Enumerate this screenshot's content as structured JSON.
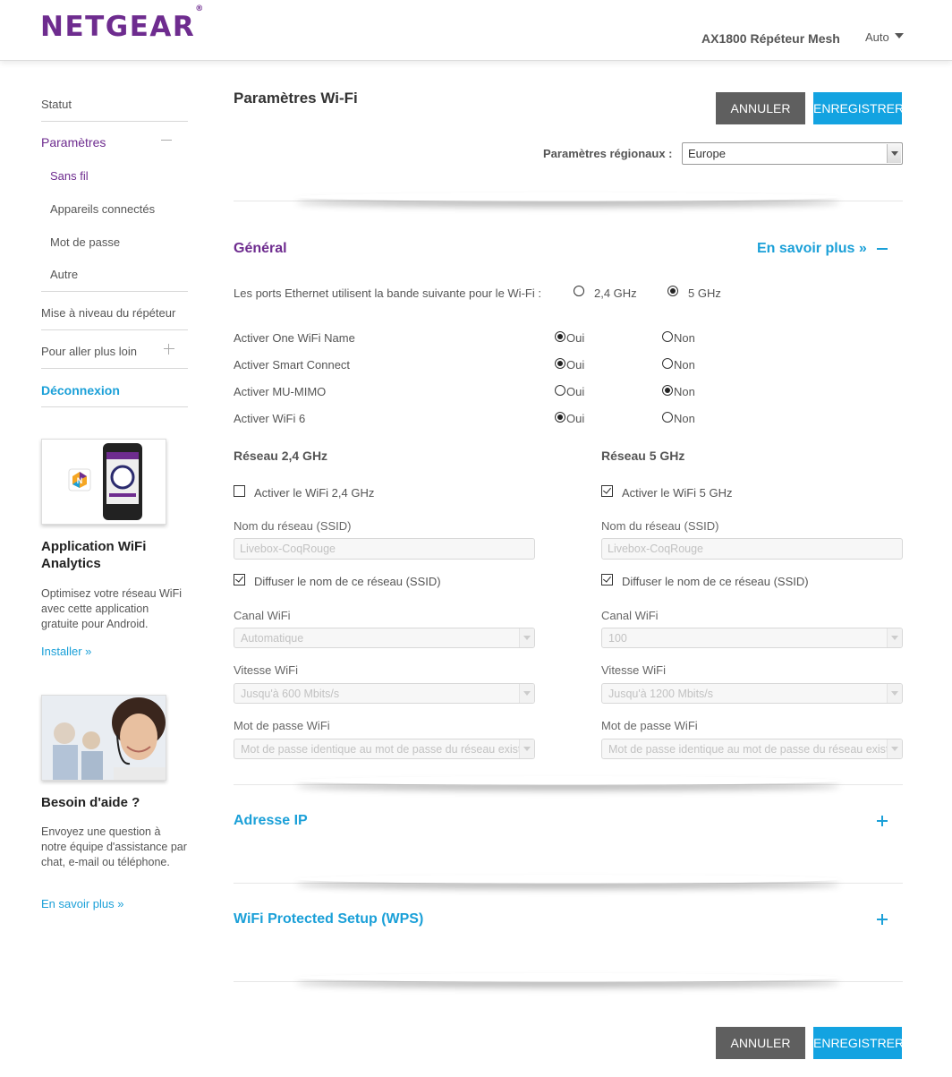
{
  "header": {
    "logo": "NETGEAR",
    "logo_mark": "®",
    "product": "AX1800 Répéteur Mesh",
    "language": "Auto"
  },
  "sidebar": {
    "items": [
      {
        "label": "Statut"
      },
      {
        "label": "Paramètres"
      },
      {
        "label": "Sans fil"
      },
      {
        "label": "Appareils connectés"
      },
      {
        "label": "Mot de passe"
      },
      {
        "label": "Autre"
      },
      {
        "label": "Mise à niveau du répéteur"
      },
      {
        "label": "Pour aller plus loin"
      },
      {
        "label": "Déconnexion"
      }
    ],
    "promo_app": {
      "title": "Application WiFi Analytics",
      "text": "Optimisez votre réseau WiFi avec cette application gratuite pour Android.",
      "link": "Installer »"
    },
    "promo_help": {
      "title": "Besoin d'aide ?",
      "text": "Envoyez une question à notre équipe d'assistance par chat, e-mail ou téléphone.",
      "link": "En savoir plus »"
    }
  },
  "main": {
    "title": "Paramètres Wi-Fi",
    "cancel_label": "ANNULER",
    "save_label": "ENREGISTRER",
    "region_label": "Paramètres régionaux :",
    "region_value": "Europe",
    "general": {
      "title": "Général",
      "learn_more": "En savoir plus »",
      "ethernet_label": "Les ports Ethernet utilisent la bande suivante pour le Wi-Fi :",
      "band_24": "2,4 GHz",
      "band_5": "5 GHz",
      "band_selected": "5 GHz",
      "yes_label": "Oui",
      "no_label": "Non",
      "options": [
        {
          "label": "Activer One WiFi Name",
          "value": "Oui"
        },
        {
          "label": "Activer Smart Connect",
          "value": "Oui"
        },
        {
          "label": "Activer MU-MIMO",
          "value": "Non"
        },
        {
          "label": "Activer WiFi 6",
          "value": "Oui"
        }
      ]
    },
    "net24": {
      "title": "Réseau 2,4 GHz",
      "enable_label": "Activer le WiFi 2,4 GHz",
      "enabled": false,
      "ssid_label": "Nom du réseau (SSID)",
      "ssid_value": "Livebox-CoqRouge",
      "broadcast_label": "Diffuser le nom de ce réseau (SSID)",
      "broadcast": true,
      "channel_label": "Canal WiFi",
      "channel_value": "Automatique",
      "speed_label": "Vitesse WiFi",
      "speed_value": "Jusqu'à 600 Mbits/s",
      "password_label": "Mot de passe WiFi",
      "password_value": "Mot de passe identique au mot de passe du réseau existant"
    },
    "net5": {
      "title": "Réseau 5 GHz",
      "enable_label": "Activer le WiFi 5 GHz",
      "enabled": true,
      "ssid_label": "Nom du réseau (SSID)",
      "ssid_value": "Livebox-CoqRouge",
      "broadcast_label": "Diffuser le nom de ce réseau (SSID)",
      "broadcast": true,
      "channel_label": "Canal WiFi",
      "channel_value": "100",
      "speed_label": "Vitesse WiFi",
      "speed_value": "Jusqu'à 1200 Mbits/s",
      "password_label": "Mot de passe WiFi",
      "password_value": "Mot de passe identique au mot de passe du réseau existant"
    },
    "ip_section": {
      "title": "Adresse IP"
    },
    "wps_section": {
      "title": "WiFi Protected Setup (WPS)"
    }
  },
  "colors": {
    "brand_purple": "#6e2c8f",
    "accent_blue": "#1ba0d8",
    "cancel_gray": "#5f5f5f"
  },
  "icons": [
    "caret-down-icon",
    "minus-icon",
    "plus-icon",
    "checkbox-icon",
    "radio-icon"
  ]
}
